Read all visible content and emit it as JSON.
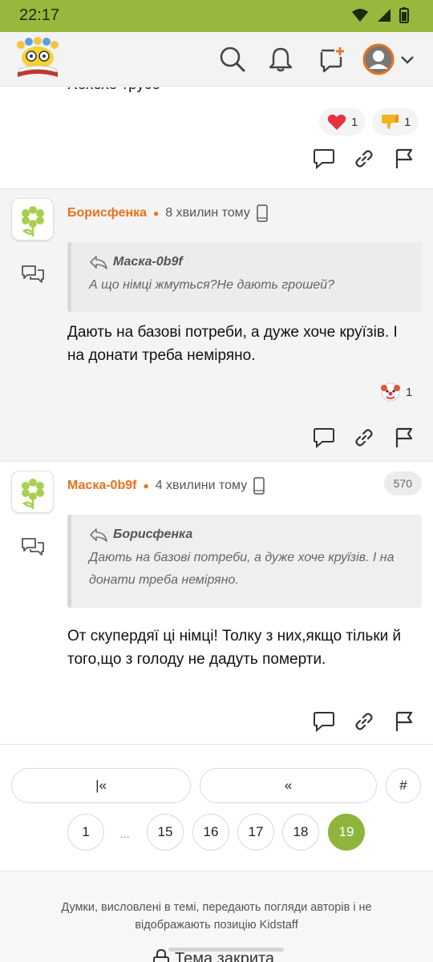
{
  "status_bar": {
    "time": "22:17"
  },
  "colors": {
    "status_bar": "#97b83c",
    "accent": "#8db53c",
    "author": "#e8711c"
  },
  "top_post": {
    "cut_text": "Хехехе трусо",
    "reactions": [
      {
        "icon": "heart-icon",
        "count": "1"
      },
      {
        "icon": "thumbs-down-icon",
        "count": "1"
      }
    ]
  },
  "posts": [
    {
      "author": "Борисфенка",
      "time_ago": "8 хвилин тому",
      "quote_author": "Маска-0b9f",
      "quote_text": "А що німці жмуться?Не дають грошей?",
      "body": "Дають на базові потреби, а дуже хоче круїзів. І на донати треба неміряно.",
      "reaction_icon": "clown-face-icon",
      "reaction_count": "1"
    },
    {
      "author": "Маска-0b9f",
      "time_ago": "4 хвилини тому",
      "post_number": "570",
      "quote_author": "Борисфенка",
      "quote_text": "Дають на базові потреби, а дуже хоче круїзів. І на донати треба неміряно.",
      "body": "От скупердяї ці німці! Толку з них,якщо тільки й того,що з голоду не дадуть померти."
    }
  ],
  "pagination": {
    "first_label": "|«",
    "prev_label": "«",
    "goto_label": "#",
    "ellipsis": "...",
    "pages": [
      "1",
      "15",
      "16",
      "17",
      "18",
      "19"
    ],
    "current_page": "19"
  },
  "footer": {
    "disclaimer": "Думки, висловлені в темі, передають погляди авторів і не відображають позицію Kidstaff",
    "topic_closed": "Тема закрита"
  }
}
